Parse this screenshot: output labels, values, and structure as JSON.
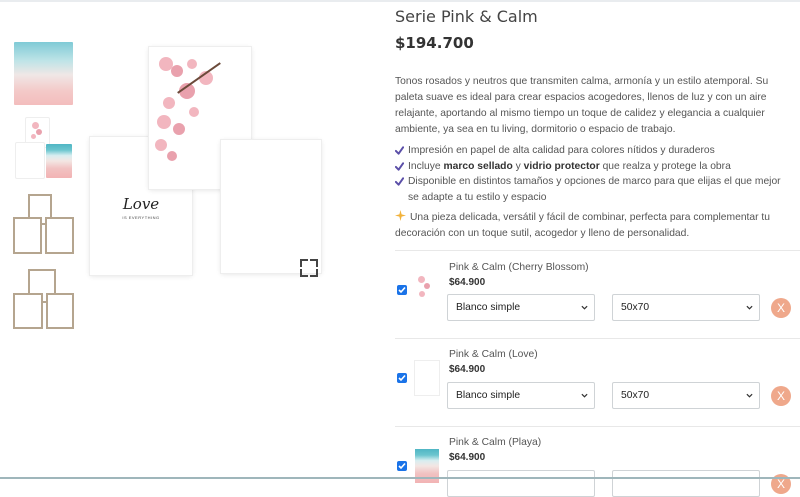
{
  "product": {
    "title": "Serie Pink & Calm",
    "price": "$194.700",
    "description": "Tonos rosados y neutros que transmiten calma, armonía y un estilo atemporal. Su paleta suave es ideal para crear espacios acogedores, llenos de luz y con un aire relajante, aportando al mismo tiempo un toque de calidez y elegancia a cualquier ambiente, ya sea en tu living, dormitorio o espacio de trabajo.",
    "bullets": [
      {
        "pre": "Impresión en papel de alta calidad para colores nítidos y duraderos"
      },
      {
        "pre": "Incluye ",
        "bold1": "marco sellado",
        "mid": " y ",
        "bold2": "vidrio protector",
        "post": " que realza y protege la obra"
      },
      {
        "pre": "Disponible en distintos tamaños y opciones de marco para que elijas el que mejor se adapte a tu estilo y espacio"
      }
    ],
    "note": "Una pieza delicada, versátil y fácil de combinar, perfecta para complementar tu decoración con un toque sutil, acogedor y lleno de personalidad.",
    "main_image_text": {
      "word": "Love",
      "sub": "IS EVERYTHING"
    }
  },
  "items": [
    {
      "name": "Pink & Calm (Cherry Blossom)",
      "price": "$64.900",
      "frame": "Blanco simple",
      "size": "50x70",
      "remove": "X"
    },
    {
      "name": "Pink & Calm (Love)",
      "price": "$64.900",
      "frame": "Blanco simple",
      "size": "50x70",
      "remove": "X"
    },
    {
      "name": "Pink & Calm (Playa)",
      "price": "$64.900",
      "frame": "",
      "size": "",
      "remove": "X"
    }
  ],
  "colors": {
    "accent": "#efa88b",
    "check": "#5b4fa8",
    "checkbox": "#1a73e8"
  }
}
